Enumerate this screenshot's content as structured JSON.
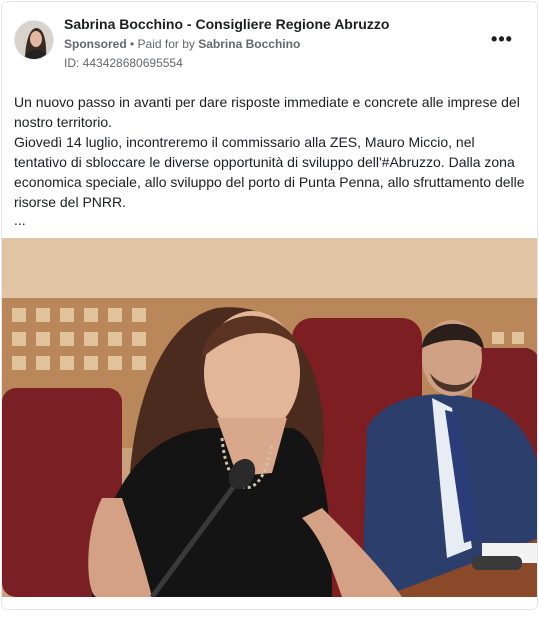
{
  "ad": {
    "page_name": "Sabrina Bocchino - Consigliere Regione Abruzzo",
    "sponsored_label": "Sponsored",
    "separator": " • ",
    "paid_for_prefix": "Paid for by ",
    "paid_for_name": "Sabrina Bocchino",
    "id_text": "ID: 443428680695554",
    "more_icon": "•••"
  },
  "body": {
    "paragraph_1": "Un nuovo passo in avanti per dare risposte immediate e concrete alle imprese del nostro territorio.",
    "paragraph_2": "Giovedì 14 luglio, incontreremo il commissario alla ZES, Mauro Miccio, nel tentativo di sbloccare le diverse opportunità di sviluppo dell'#Abruzzo. Dalla zona economica speciale, allo sviluppo del porto di Punta Penna, allo sfruttamento delle risorse del PNRR.",
    "ellipsis": "..."
  },
  "colors": {
    "text": "#1c1e21",
    "secondary": "#65676b",
    "border": "#e4e6eb"
  }
}
